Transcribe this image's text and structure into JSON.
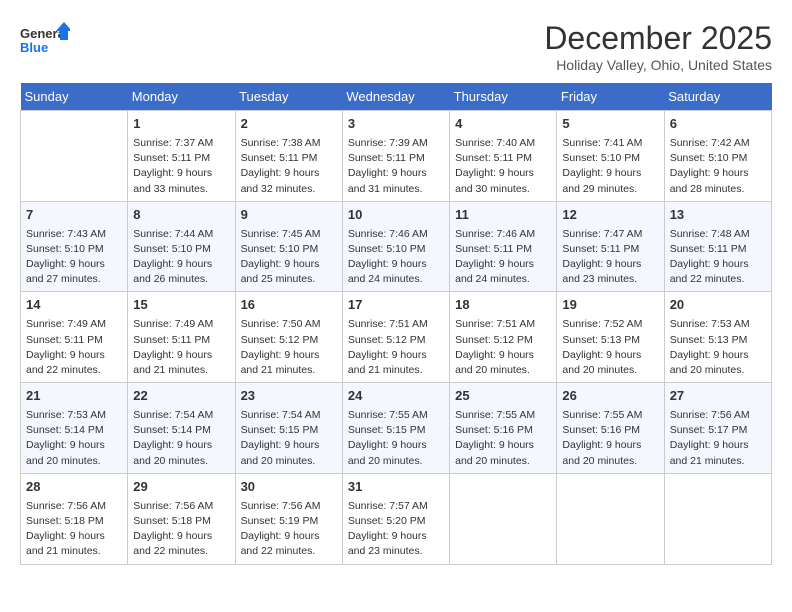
{
  "logo": {
    "line1": "General",
    "line2": "Blue"
  },
  "title": "December 2025",
  "subtitle": "Holiday Valley, Ohio, United States",
  "headers": [
    "Sunday",
    "Monday",
    "Tuesday",
    "Wednesday",
    "Thursday",
    "Friday",
    "Saturday"
  ],
  "weeks": [
    [
      {
        "day": "",
        "content": ""
      },
      {
        "day": "1",
        "content": "Sunrise: 7:37 AM\nSunset: 5:11 PM\nDaylight: 9 hours\nand 33 minutes."
      },
      {
        "day": "2",
        "content": "Sunrise: 7:38 AM\nSunset: 5:11 PM\nDaylight: 9 hours\nand 32 minutes."
      },
      {
        "day": "3",
        "content": "Sunrise: 7:39 AM\nSunset: 5:11 PM\nDaylight: 9 hours\nand 31 minutes."
      },
      {
        "day": "4",
        "content": "Sunrise: 7:40 AM\nSunset: 5:11 PM\nDaylight: 9 hours\nand 30 minutes."
      },
      {
        "day": "5",
        "content": "Sunrise: 7:41 AM\nSunset: 5:10 PM\nDaylight: 9 hours\nand 29 minutes."
      },
      {
        "day": "6",
        "content": "Sunrise: 7:42 AM\nSunset: 5:10 PM\nDaylight: 9 hours\nand 28 minutes."
      }
    ],
    [
      {
        "day": "7",
        "content": "Sunrise: 7:43 AM\nSunset: 5:10 PM\nDaylight: 9 hours\nand 27 minutes."
      },
      {
        "day": "8",
        "content": "Sunrise: 7:44 AM\nSunset: 5:10 PM\nDaylight: 9 hours\nand 26 minutes."
      },
      {
        "day": "9",
        "content": "Sunrise: 7:45 AM\nSunset: 5:10 PM\nDaylight: 9 hours\nand 25 minutes."
      },
      {
        "day": "10",
        "content": "Sunrise: 7:46 AM\nSunset: 5:10 PM\nDaylight: 9 hours\nand 24 minutes."
      },
      {
        "day": "11",
        "content": "Sunrise: 7:46 AM\nSunset: 5:11 PM\nDaylight: 9 hours\nand 24 minutes."
      },
      {
        "day": "12",
        "content": "Sunrise: 7:47 AM\nSunset: 5:11 PM\nDaylight: 9 hours\nand 23 minutes."
      },
      {
        "day": "13",
        "content": "Sunrise: 7:48 AM\nSunset: 5:11 PM\nDaylight: 9 hours\nand 22 minutes."
      }
    ],
    [
      {
        "day": "14",
        "content": "Sunrise: 7:49 AM\nSunset: 5:11 PM\nDaylight: 9 hours\nand 22 minutes."
      },
      {
        "day": "15",
        "content": "Sunrise: 7:49 AM\nSunset: 5:11 PM\nDaylight: 9 hours\nand 21 minutes."
      },
      {
        "day": "16",
        "content": "Sunrise: 7:50 AM\nSunset: 5:12 PM\nDaylight: 9 hours\nand 21 minutes."
      },
      {
        "day": "17",
        "content": "Sunrise: 7:51 AM\nSunset: 5:12 PM\nDaylight: 9 hours\nand 21 minutes."
      },
      {
        "day": "18",
        "content": "Sunrise: 7:51 AM\nSunset: 5:12 PM\nDaylight: 9 hours\nand 20 minutes."
      },
      {
        "day": "19",
        "content": "Sunrise: 7:52 AM\nSunset: 5:13 PM\nDaylight: 9 hours\nand 20 minutes."
      },
      {
        "day": "20",
        "content": "Sunrise: 7:53 AM\nSunset: 5:13 PM\nDaylight: 9 hours\nand 20 minutes."
      }
    ],
    [
      {
        "day": "21",
        "content": "Sunrise: 7:53 AM\nSunset: 5:14 PM\nDaylight: 9 hours\nand 20 minutes."
      },
      {
        "day": "22",
        "content": "Sunrise: 7:54 AM\nSunset: 5:14 PM\nDaylight: 9 hours\nand 20 minutes."
      },
      {
        "day": "23",
        "content": "Sunrise: 7:54 AM\nSunset: 5:15 PM\nDaylight: 9 hours\nand 20 minutes."
      },
      {
        "day": "24",
        "content": "Sunrise: 7:55 AM\nSunset: 5:15 PM\nDaylight: 9 hours\nand 20 minutes."
      },
      {
        "day": "25",
        "content": "Sunrise: 7:55 AM\nSunset: 5:16 PM\nDaylight: 9 hours\nand 20 minutes."
      },
      {
        "day": "26",
        "content": "Sunrise: 7:55 AM\nSunset: 5:16 PM\nDaylight: 9 hours\nand 20 minutes."
      },
      {
        "day": "27",
        "content": "Sunrise: 7:56 AM\nSunset: 5:17 PM\nDaylight: 9 hours\nand 21 minutes."
      }
    ],
    [
      {
        "day": "28",
        "content": "Sunrise: 7:56 AM\nSunset: 5:18 PM\nDaylight: 9 hours\nand 21 minutes."
      },
      {
        "day": "29",
        "content": "Sunrise: 7:56 AM\nSunset: 5:18 PM\nDaylight: 9 hours\nand 22 minutes."
      },
      {
        "day": "30",
        "content": "Sunrise: 7:56 AM\nSunset: 5:19 PM\nDaylight: 9 hours\nand 22 minutes."
      },
      {
        "day": "31",
        "content": "Sunrise: 7:57 AM\nSunset: 5:20 PM\nDaylight: 9 hours\nand 23 minutes."
      },
      {
        "day": "",
        "content": ""
      },
      {
        "day": "",
        "content": ""
      },
      {
        "day": "",
        "content": ""
      }
    ]
  ]
}
